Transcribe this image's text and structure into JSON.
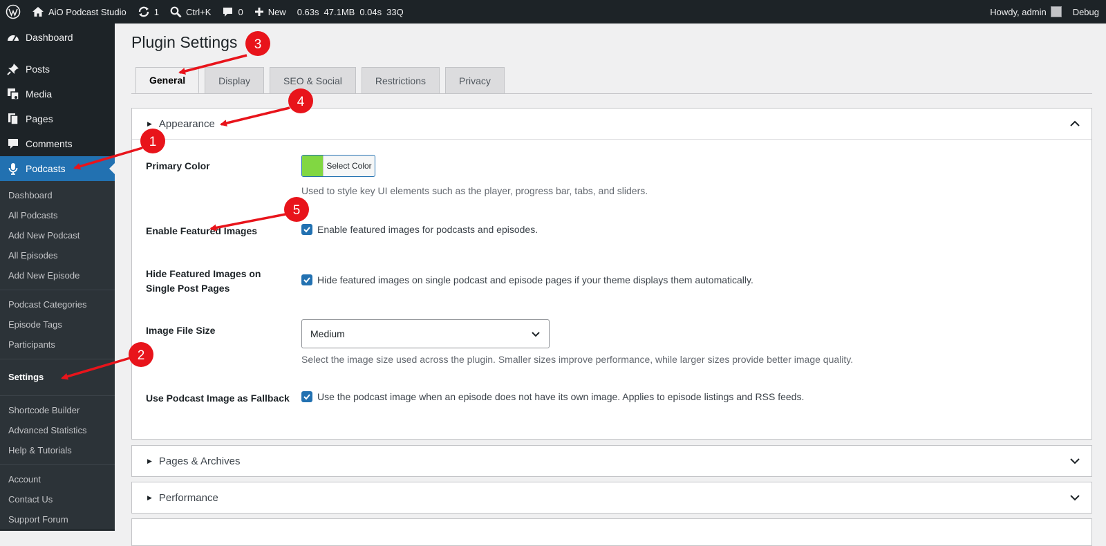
{
  "adminbar": {
    "site_name": "AiO Podcast Studio",
    "updates_count": "1",
    "search_shortcut": "Ctrl+K",
    "comments_count": "0",
    "new_label": "New",
    "perf_time": "0.63s",
    "perf_memory": "47.1MB",
    "perf_query_time": "0.04s",
    "perf_queries": "33Q",
    "howdy": "Howdy, admin",
    "debug": "Debug"
  },
  "sidebar": {
    "dashboard": "Dashboard",
    "posts": "Posts",
    "media": "Media",
    "pages": "Pages",
    "comments": "Comments",
    "podcasts": "Podcasts",
    "submenu": [
      "Dashboard",
      "All Podcasts",
      "Add New Podcast",
      "All Episodes",
      "Add New Episode",
      "Podcast Categories",
      "Episode Tags",
      "Participants",
      "Settings",
      "Shortcode Builder",
      "Advanced Statistics",
      "Help & Tutorials",
      "Account",
      "Contact Us",
      "Support Forum"
    ]
  },
  "main": {
    "title": "Plugin Settings",
    "tabs": [
      "General",
      "Display",
      "SEO & Social",
      "Restrictions",
      "Privacy"
    ],
    "appearance": {
      "heading": "Appearance",
      "primary_color_label": "Primary Color",
      "select_color": "Select Color",
      "primary_color_value": "#81d742",
      "primary_color_desc": "Used to style key UI elements such as the player, progress bar, tabs, and sliders.",
      "featured_label": "Enable Featured Images",
      "featured_desc": "Enable featured images for podcasts and episodes.",
      "hide_label": "Hide Featured Images on Single Post Pages",
      "hide_desc": "Hide featured images on single podcast and episode pages if your theme displays them automatically.",
      "size_label": "Image File Size",
      "size_value": "Medium",
      "size_desc": "Select the image size used across the plugin. Smaller sizes improve performance, while larger sizes provide better image quality.",
      "fallback_label": "Use Podcast Image as Fallback",
      "fallback_desc": "Use the podcast image when an episode does not have its own image. Applies to episode listings and RSS feeds."
    },
    "pages_archives": "Pages & Archives",
    "performance": "Performance"
  },
  "annotations": [
    "1",
    "2",
    "3",
    "4",
    "5"
  ],
  "colors": {
    "accent": "#2271b1",
    "annotation": "#e8141b",
    "admin_bg": "#1d2327"
  }
}
